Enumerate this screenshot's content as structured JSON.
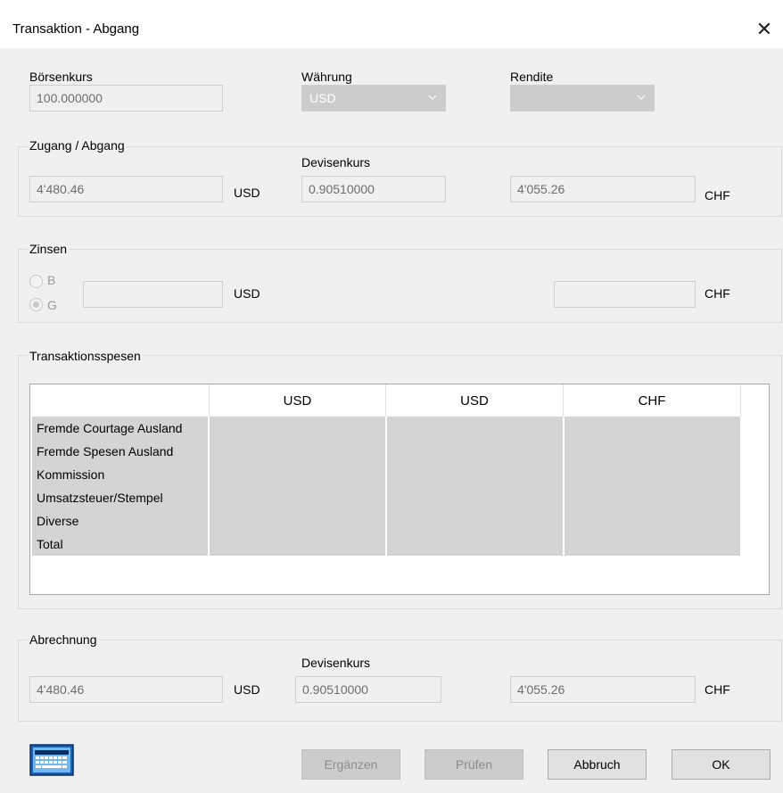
{
  "window": {
    "title": "Transaktion - Abgang",
    "close_glyph": "✕"
  },
  "top": {
    "boersenkurs_label": "Börsenkurs",
    "boersenkurs_value": "100.000000",
    "waehrung_label": "Währung",
    "waehrung_value": "USD",
    "rendite_label": "Rendite",
    "rendite_value": ""
  },
  "zugang": {
    "title": "Zugang / Abgang",
    "amount": "4'480.46",
    "unit_left": "USD",
    "devisenkurs_label": "Devisenkurs",
    "devisenkurs_value": "0.90510000",
    "amount_chf": "4'055.26",
    "unit_right": "CHF"
  },
  "zinsen": {
    "title": "Zinsen",
    "radio_b": "B",
    "radio_g": "G",
    "amount": "",
    "unit_left": "USD",
    "amount_chf": "",
    "unit_right": "CHF"
  },
  "spesen": {
    "title": "Transaktionsspesen",
    "columns": [
      "",
      "USD",
      "USD",
      "CHF"
    ],
    "rows": [
      "Fremde Courtage Ausland",
      "Fremde Spesen Ausland",
      "Kommission",
      "Umsatzsteuer/Stempel",
      "Diverse",
      "Total"
    ]
  },
  "abrechnung": {
    "title": "Abrechnung",
    "amount": "4'480.46",
    "unit_left": "USD",
    "devisenkurs_label": "Devisenkurs",
    "devisenkurs_value": "0.90510000",
    "amount_chf": "4'055.26",
    "unit_right": "CHF"
  },
  "buttons": {
    "ergaenzen": "Ergänzen",
    "pruefen": "Prüfen",
    "abbruch": "Abbruch",
    "ok": "OK"
  },
  "icons": {
    "keyboard": "keyboard-icon",
    "chevron": "chevron-down-icon",
    "close": "close-icon"
  },
  "colors": {
    "disabled_text": "#6d6d6d",
    "grid_cell": "#d4d4d4",
    "keyboard_blue": "#1a5fb4"
  }
}
